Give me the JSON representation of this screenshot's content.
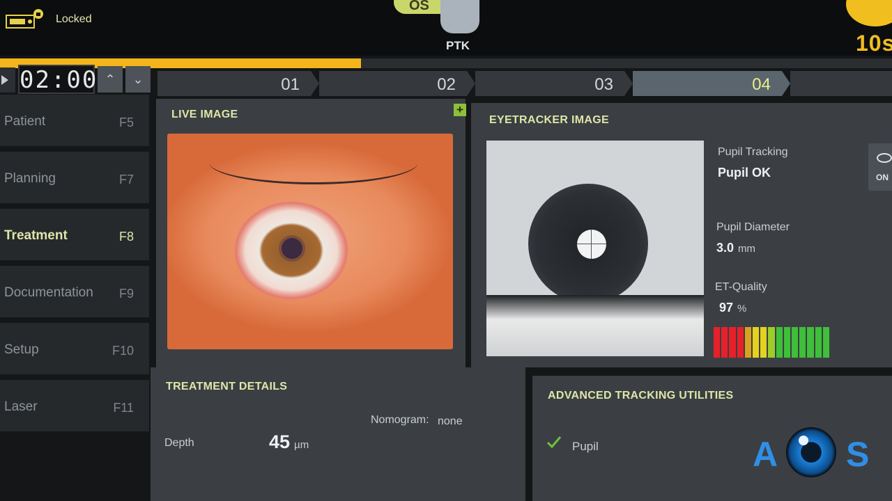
{
  "header": {
    "lock_status": "Locked",
    "eye_selector": "OS",
    "mode": "PTK",
    "laser_timer": "10s",
    "progress_fraction": 0.405
  },
  "timer": {
    "value": "02:00",
    "up_glyph": "⌃",
    "down_glyph": "⌄"
  },
  "sidebar": {
    "items": [
      {
        "label": "Patient",
        "key": "F5"
      },
      {
        "label": "Planning",
        "key": "F7"
      },
      {
        "label": "Treatment",
        "key": "F8",
        "active": true
      },
      {
        "label": "Documentation",
        "key": "F9"
      },
      {
        "label": "Setup",
        "key": "F10"
      },
      {
        "label": "Laser",
        "key": "F11"
      }
    ]
  },
  "steps": [
    {
      "label": "01"
    },
    {
      "label": "02"
    },
    {
      "label": "03"
    },
    {
      "label": "04",
      "active": true
    }
  ],
  "live_image": {
    "title": "LIVE IMAGE",
    "add_glyph": "+"
  },
  "eyetracker": {
    "title": "EYETRACKER IMAGE",
    "pupil_tracking_label": "Pupil Tracking",
    "pupil_tracking_value": "Pupil OK",
    "pupil_diameter_label": "Pupil Diameter",
    "pupil_diameter_value": "3.0",
    "pupil_diameter_unit": "mm",
    "quality_label": "ET-Quality",
    "quality_value": "97",
    "quality_unit": "%",
    "quality_segments": [
      "#e8202a",
      "#e8202a",
      "#e8202a",
      "#e8202a",
      "#d9a21e",
      "#e4d21f",
      "#e4d21f",
      "#9ccd2a",
      "#3fbf3a",
      "#3fbf3a",
      "#3fbf3a",
      "#3fbf3a",
      "#3fbf3a",
      "#3fbf3a",
      "#3fbf3a"
    ],
    "toggle_label": "ON"
  },
  "treatment_details": {
    "title": "TREATMENT DETAILS",
    "nomogram_label": "Nomogram:",
    "nomogram_value": "none",
    "depth_label": "Depth",
    "depth_value": "45",
    "depth_unit": "µm"
  },
  "advanced_tracking": {
    "title": "ADVANCED TRACKING UTILITIES",
    "pupil_label": "Pupil"
  },
  "logo": {
    "left_letter": "A",
    "right_letter": "S"
  },
  "colors": {
    "accent": "#dfe6a8",
    "progress": "#f3b51a",
    "check": "#6ec43a"
  }
}
